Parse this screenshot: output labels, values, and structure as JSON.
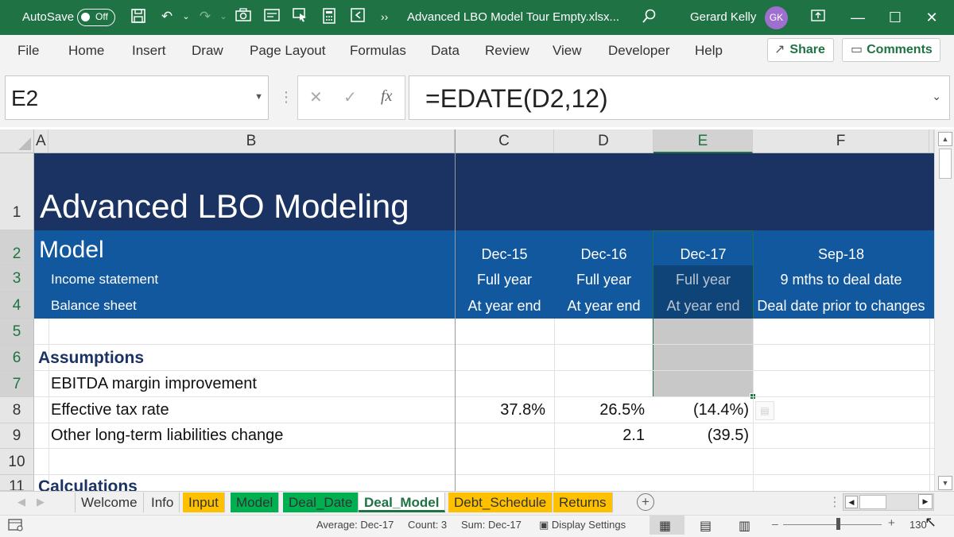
{
  "titlebar": {
    "autosave_label": "AutoSave",
    "autosave_state": "Off",
    "more_label": "››",
    "file_title": "Advanced LBO Model Tour Empty.xlsx...",
    "user_name": "Gerard Kelly",
    "user_initials": "GK",
    "colors": {
      "bar": "#1f7244",
      "avatar": "#9f6fd0"
    }
  },
  "ribbon": {
    "tabs": [
      "File",
      "Home",
      "Insert",
      "Draw",
      "Page Layout",
      "Formulas",
      "Data",
      "Review",
      "View",
      "Developer",
      "Help"
    ],
    "share_label": "Share",
    "comments_label": "Comments"
  },
  "formula_bar": {
    "name_box": "E2",
    "formula": "=EDATE(D2,12)"
  },
  "columns": [
    "A",
    "B",
    "C",
    "D",
    "E",
    "F"
  ],
  "selected_column": "E",
  "rows": [
    "1",
    "2",
    "3",
    "4",
    "5",
    "6",
    "7",
    "8",
    "9",
    "10",
    "11"
  ],
  "sheet": {
    "title": "Advanced LBO Modeling",
    "model_label": "Model",
    "income_statement": "Income statement",
    "balance_sheet": "Balance sheet",
    "periods": [
      {
        "date": "Dec-15",
        "is": "Full year",
        "bs": "At year end"
      },
      {
        "date": "Dec-16",
        "is": "Full year",
        "bs": "At year end"
      },
      {
        "date": "Dec-17",
        "is": "Full year",
        "bs": "At year end"
      },
      {
        "date": "Sep-18",
        "is": "9 mths to deal date",
        "bs": "Deal date prior to changes"
      }
    ],
    "assumptions_label": "Assumptions",
    "ebitda_label": "EBITDA margin improvement",
    "tax_label": "Effective tax rate",
    "tax_values": [
      "37.8%",
      "26.5%",
      "(14.4%)"
    ],
    "olt_label": "Other long-term liabilities change",
    "olt_values": [
      "",
      "2.1",
      "(39.5)"
    ],
    "calculations_label": "Calculations",
    "colors": {
      "title_band": "#1b3362",
      "header_band": "#12589f",
      "section": "#1b3362"
    }
  },
  "sheet_tabs": [
    {
      "label": "Welcome",
      "style": "plain"
    },
    {
      "label": "Info",
      "style": "plain"
    },
    {
      "label": "Input",
      "style": "yellow"
    },
    {
      "label": "Model",
      "style": "green"
    },
    {
      "label": "Deal_Date",
      "style": "green"
    },
    {
      "label": "Deal_Model",
      "style": "active"
    },
    {
      "label": "Debt_Schedule",
      "style": "yellow"
    },
    {
      "label": "Returns",
      "style": "yellow"
    }
  ],
  "status": {
    "average": "Average: Dec-17",
    "count": "Count: 3",
    "sum": "Sum: Dec-17",
    "display_settings": "Display Settings",
    "zoom": "130"
  }
}
